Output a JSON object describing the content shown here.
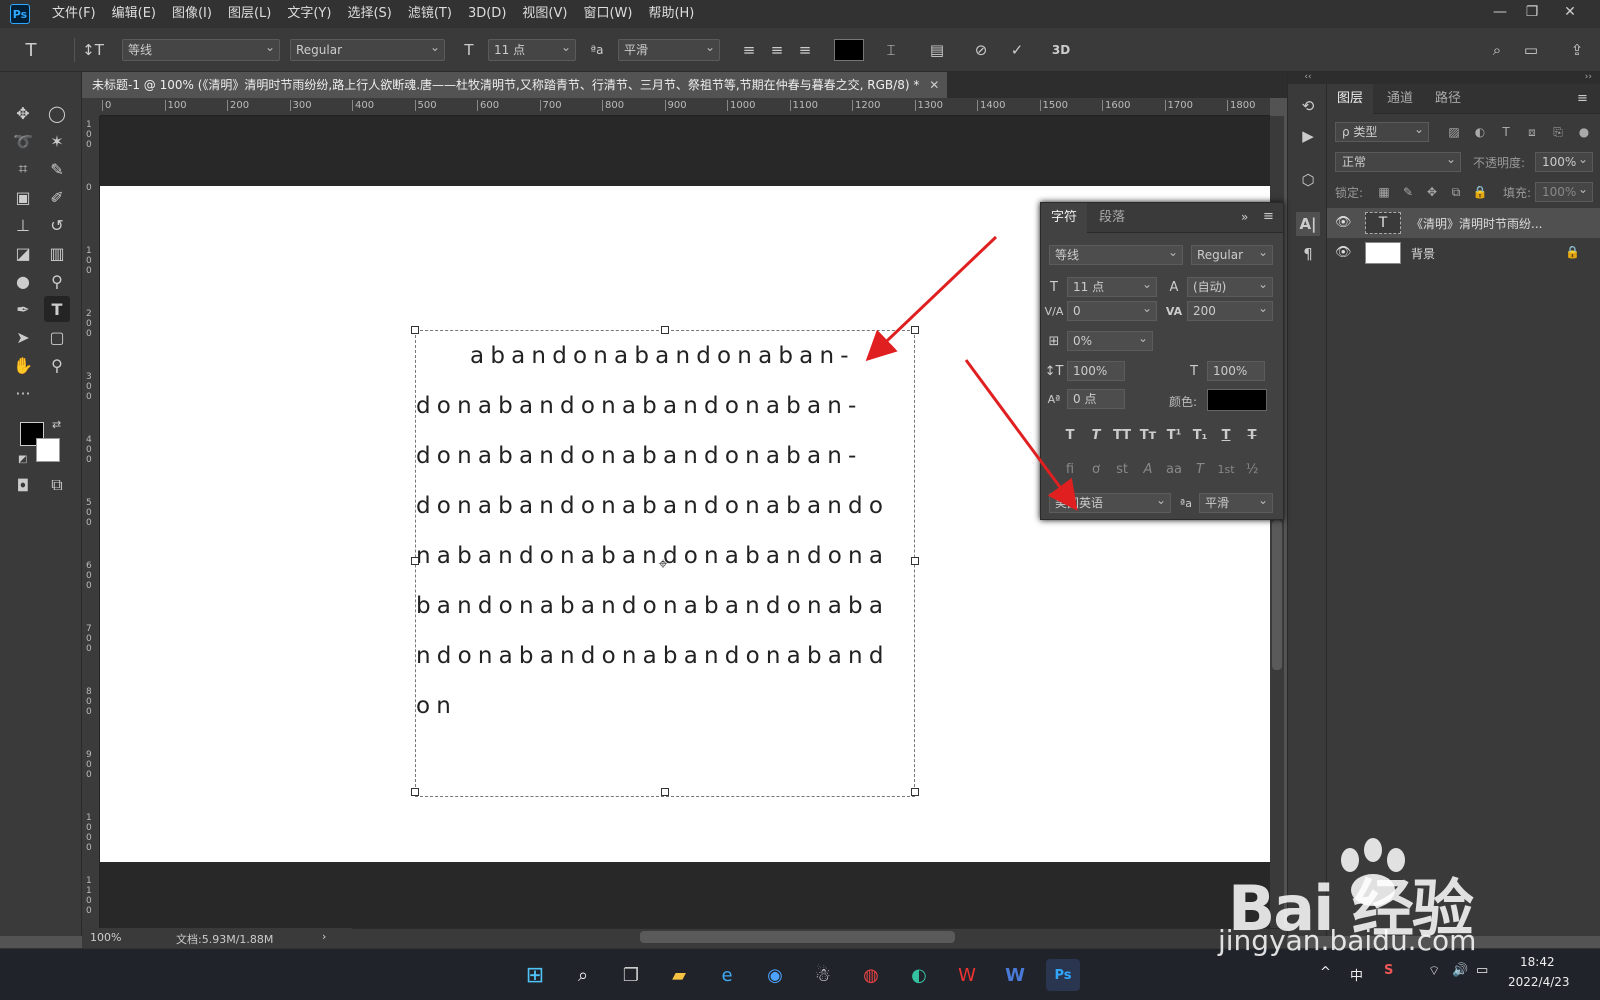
{
  "app": {
    "logo": "Ps"
  },
  "menu": [
    "文件(F)",
    "编辑(E)",
    "图像(I)",
    "图层(L)",
    "文字(Y)",
    "选择(S)",
    "滤镜(T)",
    "3D(D)",
    "视图(V)",
    "窗口(W)",
    "帮助(H)"
  ],
  "window_controls": {
    "minimize": "—",
    "restore": "❐",
    "close": "✕"
  },
  "options": {
    "font_family": "等线",
    "font_style": "Regular",
    "font_size": "11 点",
    "antialias_icon": "ªa",
    "antialias": "平滑",
    "text_color": "#000000"
  },
  "document": {
    "tab_title": "未标题-1 @ 100% (《清明》清明时节雨纷纷,路上行人欲断魂.唐——杜牧清明节,又称踏青节、行清节、三月节、祭祖节等,节期在仲春与暮春之交, RGB/8) *",
    "close": "✕"
  },
  "ruler": {
    "h": [
      "0",
      "100",
      "200",
      "300",
      "400",
      "500",
      "600",
      "700",
      "800",
      "900",
      "1000",
      "1100",
      "1200",
      "1300",
      "1400",
      "1500",
      "1600",
      "1700",
      "1800"
    ],
    "v": [
      "1\n0\n0",
      "0",
      "1\n0\n0",
      "2\n0\n0",
      "3\n0\n0",
      "4\n0\n0",
      "5\n0\n0",
      "6\n0\n0",
      "7\n0\n0",
      "8\n0\n0",
      "9\n0\n0",
      "1\n0\n0\n0",
      "1\n1\n0\n0"
    ]
  },
  "canvas_text": [
    "    abandonabandonaban-",
    "donabandonabandonaban-",
    "donabandonabandonaban-",
    "donabandonabandonabando",
    "nabandonabandonabandona",
    "bandonabandonabandonaba",
    "ndonabandonabandonaband",
    "on"
  ],
  "character_panel": {
    "tabs": [
      "字符",
      "段落"
    ],
    "font_family": "等线",
    "font_style": "Regular",
    "size": "11 点",
    "leading": "(自动)",
    "kerning": "0",
    "tracking": "200",
    "scale_pct": "0%",
    "vertical_scale": "100%",
    "horizontal_scale": "100%",
    "baseline": "0 点",
    "color_label": "颜色:",
    "color": "#000000",
    "language": "美国英语",
    "antialias_icon": "ªa",
    "antialias": "平滑",
    "style_buttons": [
      "T",
      "T",
      "TT",
      "Tт",
      "T¹",
      "T₁",
      "T",
      "T"
    ],
    "ot_buttons": [
      "fi",
      "ơ",
      "st",
      "A",
      "aa",
      "T",
      "1st",
      "½"
    ]
  },
  "layers_panel": {
    "tabs": [
      "图层",
      "通道",
      "路径"
    ],
    "filter": "ρ 类型",
    "blend": "正常",
    "opacity_label": "不透明度:",
    "opacity": "100%",
    "lock_label": "锁定:",
    "fill_label": "填充:",
    "fill": "100%",
    "layers": [
      {
        "name": "《清明》清明时节雨纷...",
        "type": "text",
        "thumb": "T"
      },
      {
        "name": "背景",
        "type": "background"
      }
    ]
  },
  "status": {
    "zoom": "100%",
    "doc": "文档:5.93M/1.88M",
    "arrow": "›"
  },
  "taskbar": {
    "tray_ime": "中",
    "time": "18:42",
    "date": "2022/4/23",
    "caret": "^"
  },
  "watermark": {
    "brand": "Bai  经验",
    "url": "jingyan.baidu.com"
  }
}
